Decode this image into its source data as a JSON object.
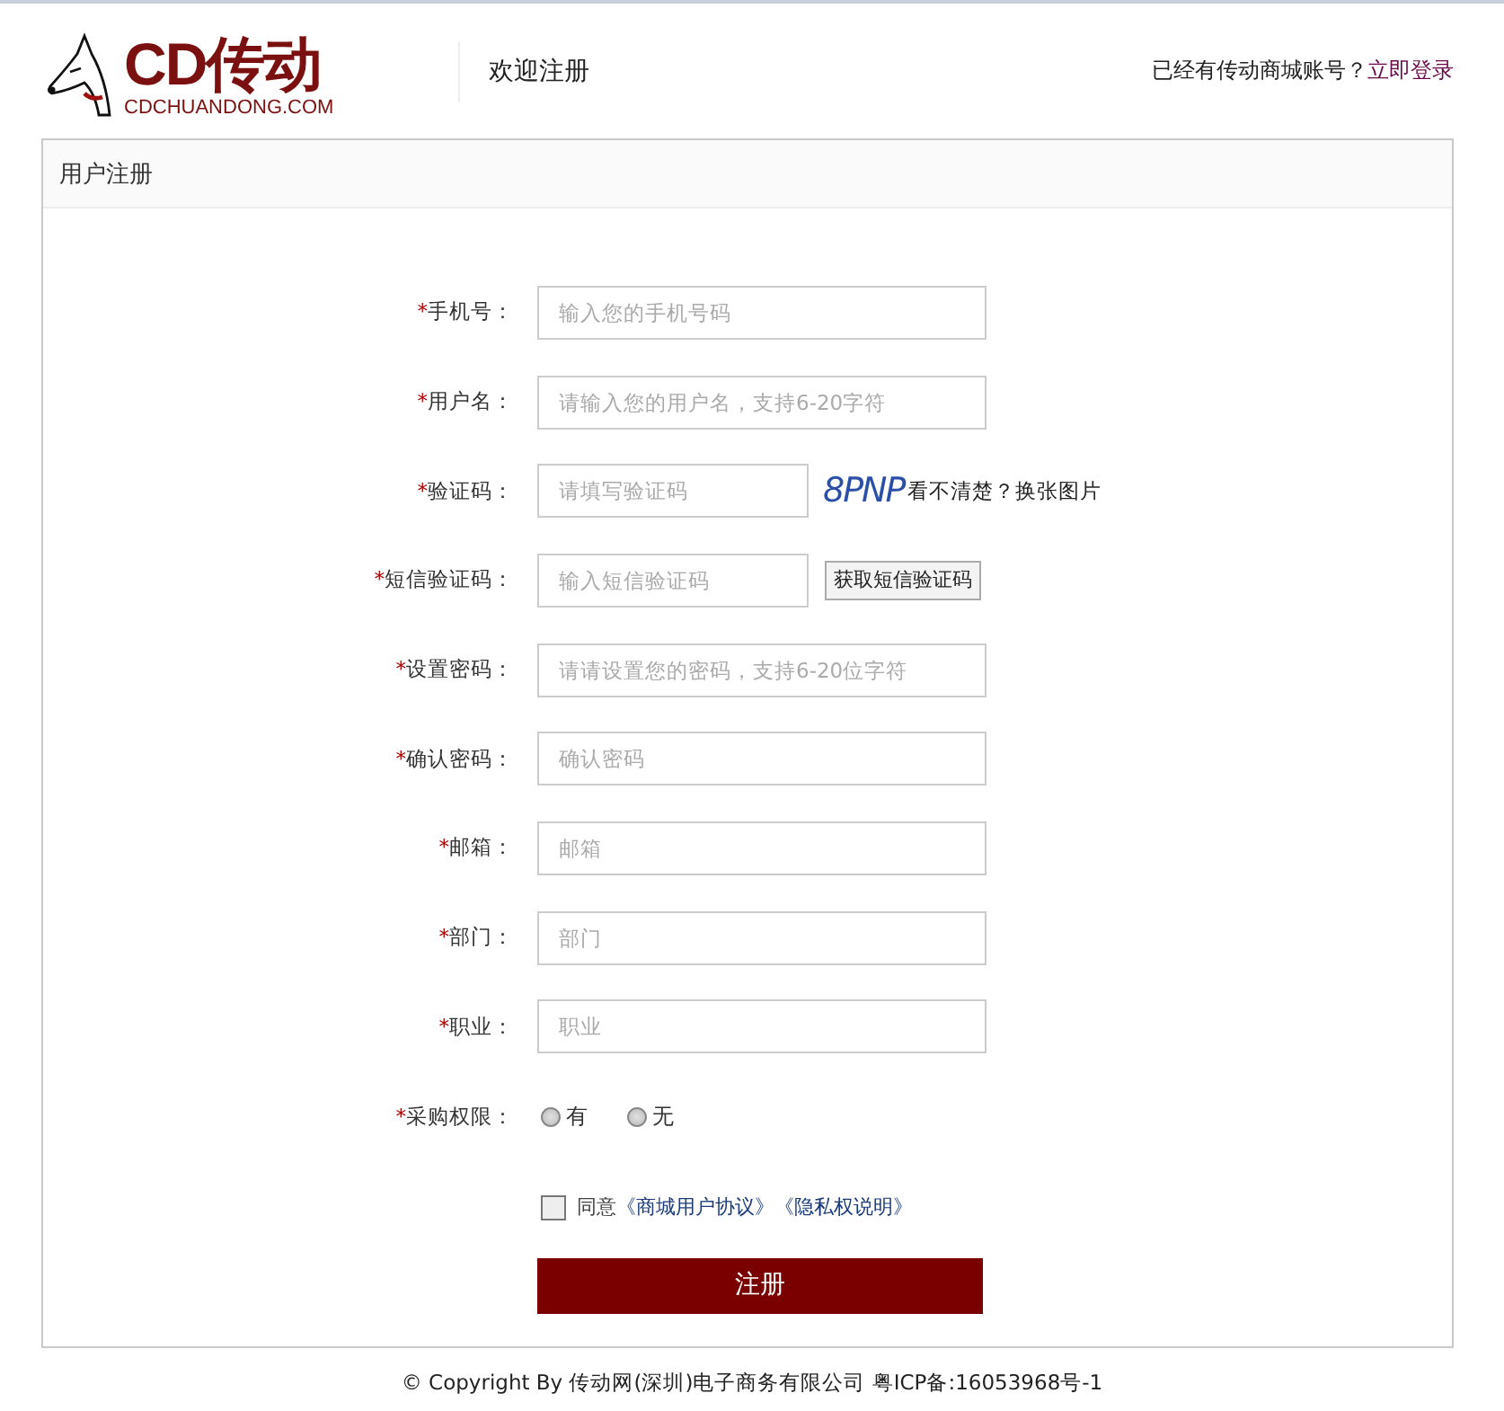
{
  "header": {
    "logo_mark": "CD传动",
    "logo_domain": "CDCHUANDONG.COM",
    "welcome": "欢迎注册",
    "login_prompt": "已经有传动商城账号？",
    "login_link": "立即登录"
  },
  "panel": {
    "title": "用户注册"
  },
  "fields": [
    {
      "kind": "text",
      "label": "手机号：",
      "placeholder": "输入您的手机号码"
    },
    {
      "kind": "text",
      "label": "用户名：",
      "placeholder": "请输入您的用户名，支持6-20字符"
    },
    {
      "kind": "captcha",
      "label": "验证码：",
      "placeholder": "请填写验证码",
      "captcha": "8PNP",
      "refresh": "看不清楚？换张图片"
    },
    {
      "kind": "sms",
      "label": "短信验证码：",
      "placeholder": "输入短信验证码",
      "button": "获取短信验证码"
    },
    {
      "kind": "text",
      "label": "设置密码：",
      "placeholder": "请请设置您的密码，支持6-20位字符"
    },
    {
      "kind": "text",
      "label": "确认密码：",
      "placeholder": "确认密码"
    },
    {
      "kind": "text",
      "label": "邮箱：",
      "placeholder": "邮箱"
    },
    {
      "kind": "text",
      "label": "部门：",
      "placeholder": "部门"
    },
    {
      "kind": "text",
      "label": "职业：",
      "placeholder": "职业"
    },
    {
      "kind": "radio",
      "label": "采购权限：",
      "options": [
        {
          "label": "有",
          "selected": false
        },
        {
          "label": "无",
          "selected": false
        }
      ]
    }
  ],
  "required_mark": "*",
  "agreement": {
    "checked": false,
    "prefix": "同意",
    "links": [
      "《商城用户协议》",
      "《隐私权说明》"
    ]
  },
  "submit": "注册",
  "footer": "© Copyright By 传动网(深圳)电子商务有限公司 粤ICP备:16053968号-1"
}
